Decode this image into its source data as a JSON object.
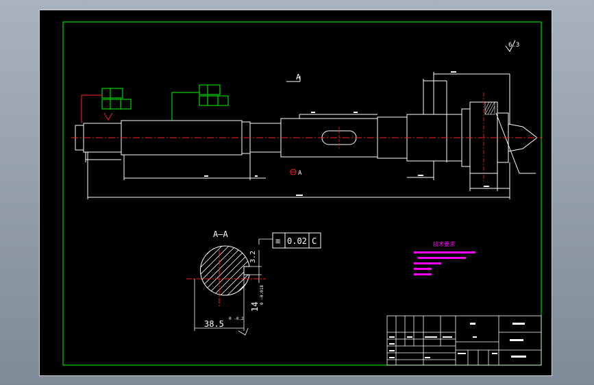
{
  "drawing": {
    "section_label": "A",
    "section_view_title": "A—A",
    "roughness_value": "6.3",
    "tolerance_frame": {
      "symbol": "≡",
      "value": "0.02",
      "datum": "C"
    },
    "keyway_depth": "3.2",
    "keyway_width": "14",
    "keyway_width_tol": "0 -0.018",
    "section_depth": "38.5",
    "section_depth_tol": "0 -0.2",
    "tech_requirements_title": "技术要求"
  },
  "colors": {
    "background": "#000000",
    "frame": "#00ff00",
    "lines": "#ffffff",
    "centerline": "#ff2020",
    "annotation": "#ff00ff"
  }
}
